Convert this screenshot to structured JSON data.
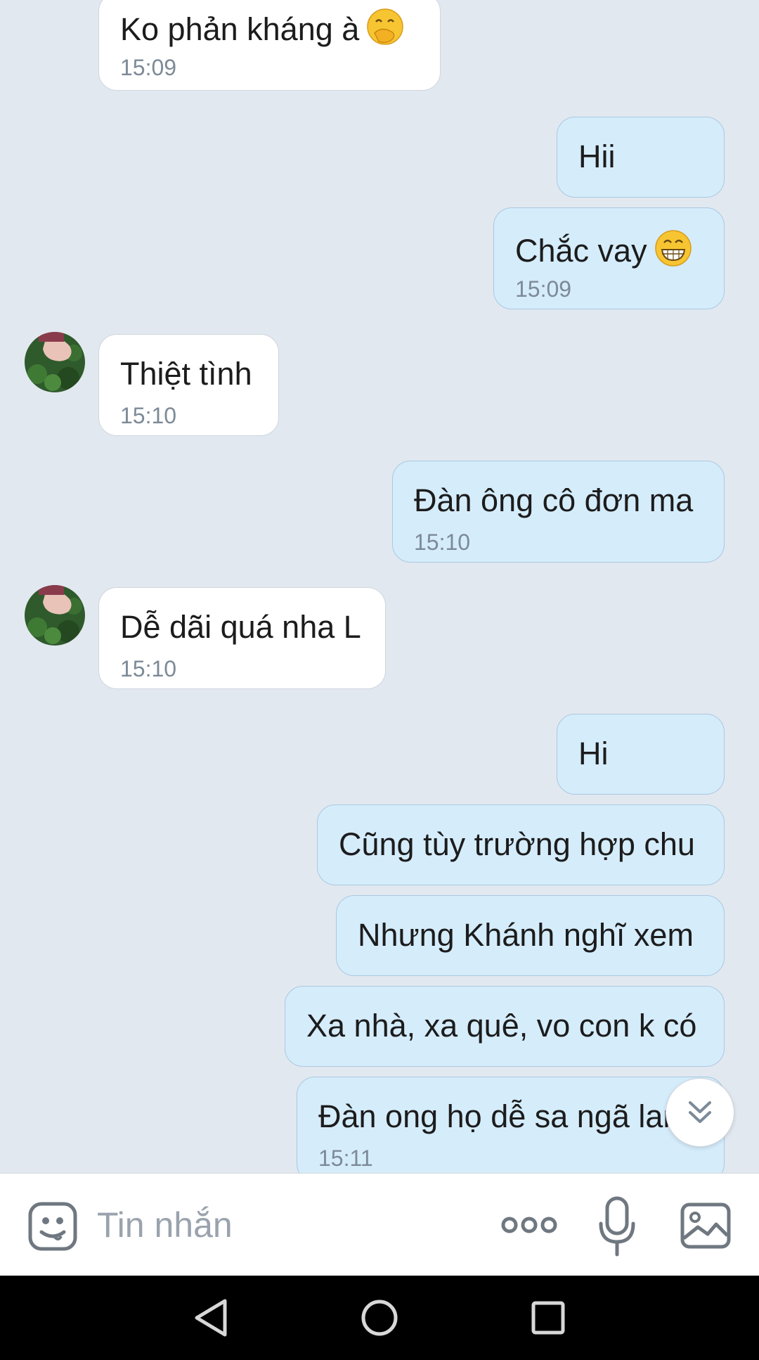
{
  "messages": [
    {
      "side": "in",
      "text": "Ko phản kháng à",
      "emoji": "hand-over-mouth-emoji",
      "time": "15:09"
    },
    {
      "side": "out",
      "text": "Hii"
    },
    {
      "side": "out",
      "text": "Chắc vay",
      "emoji": "grinning-emoji",
      "time": "15:09"
    },
    {
      "side": "in",
      "text": "Thiệt tình",
      "time": "15:10"
    },
    {
      "side": "out",
      "text": "Đàn ông cô đơn ma",
      "time": "15:10"
    },
    {
      "side": "in",
      "text": "Dễ dãi quá nha L",
      "time": "15:10"
    },
    {
      "side": "out",
      "text": "Hi"
    },
    {
      "side": "out",
      "text": "Cũng tùy trường hợp chu"
    },
    {
      "side": "out",
      "text": "Nhưng Khánh nghĩ xem"
    },
    {
      "side": "out",
      "text": "Xa nhà, xa quê, vo con k có"
    },
    {
      "side": "out",
      "text": "Đàn ong họ dễ sa ngã lam",
      "time": "15:11"
    }
  ],
  "composer": {
    "placeholder": "Tin nhắn",
    "icons": [
      "sticker-icon",
      "more-icon",
      "microphone-icon",
      "image-icon"
    ]
  },
  "navbar": {
    "icons": [
      "back-icon",
      "home-icon",
      "recents-icon"
    ]
  },
  "colors": {
    "background": "#e2e8f0",
    "incoming_bubble": "#ffffff",
    "outgoing_bubble": "#d5ecfb",
    "time_text": "#7d8a97"
  }
}
